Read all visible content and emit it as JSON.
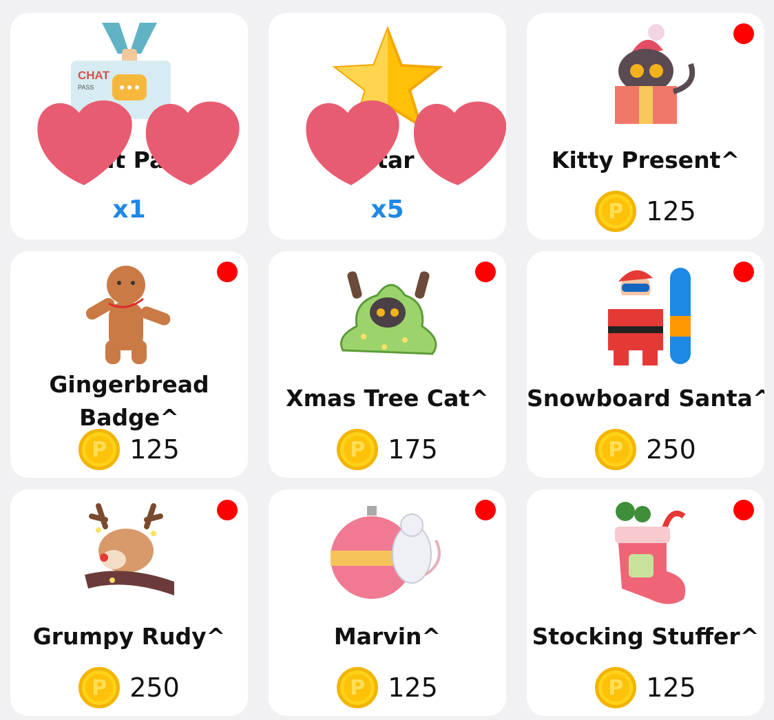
{
  "items": [
    {
      "name": "Chat Pass",
      "qty": "x1",
      "icon": "chat-pass-icon"
    },
    {
      "name": "Star",
      "qty": "x5",
      "icon": "star-icon"
    },
    {
      "name": "Kitty Present^",
      "price": "125",
      "icon": "kitty-present-icon",
      "new": true
    },
    {
      "name": "Gingerbread Badge^",
      "price": "125",
      "icon": "gingerbread-icon",
      "new": true
    },
    {
      "name": "Xmas Tree Cat^",
      "price": "175",
      "icon": "xmas-tree-cat-icon",
      "new": true
    },
    {
      "name": "Snowboard Santa^",
      "price": "250",
      "icon": "snowboard-santa-icon",
      "new": true
    },
    {
      "name": "Grumpy Rudy^",
      "price": "250",
      "icon": "reindeer-icon",
      "new": true
    },
    {
      "name": "Marvin^",
      "price": "125",
      "icon": "mouse-ornament-icon",
      "new": true
    },
    {
      "name": "Stocking Stuffer^",
      "price": "125",
      "icon": "stocking-icon",
      "new": true
    }
  ],
  "chat_pass_label": "CHAT",
  "chat_pass_sub": "PASS",
  "coin_glyph": "P",
  "colors": {
    "dot": "#ff0000",
    "qty": "#1e88e5",
    "coin": "#ffd21a",
    "heart": "#e85c72"
  }
}
